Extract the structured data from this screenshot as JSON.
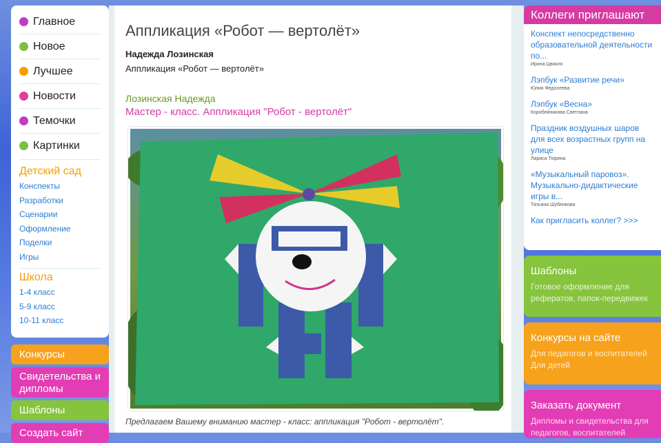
{
  "left_nav": {
    "main": [
      {
        "label": "Главное",
        "color": "#c23bc4"
      },
      {
        "label": "Новое",
        "color": "#7cc040"
      },
      {
        "label": "Лучшее",
        "color": "#f1a100"
      },
      {
        "label": "Новости",
        "color": "#e23d9b"
      },
      {
        "label": "Темочки",
        "color": "#c23bc4"
      },
      {
        "label": "Картинки",
        "color": "#7cc040"
      }
    ],
    "kindergarten": {
      "title": "Детский сад",
      "color": "#f1a100",
      "links": [
        "Конспекты",
        "Разработки",
        "Сценарии",
        "Оформление",
        "Поделки",
        "Игры"
      ]
    },
    "school": {
      "title": "Школа",
      "color": "#f1a100",
      "links": [
        "1-4 класс",
        "5-9 класс",
        "10-11 класс"
      ]
    },
    "buttons": [
      {
        "label": "Конкурсы",
        "color": "#f6a21c"
      },
      {
        "label": "Свидетельства и дипломы",
        "color": "#e23db5"
      },
      {
        "label": "Шаблоны",
        "color": "#86c43d"
      },
      {
        "label": "Создать сайт",
        "color": "#e23db5"
      }
    ]
  },
  "article": {
    "title": "Аппликация «Робот — вертолёт»",
    "author": "Надежда Лозинская",
    "subtitle": "Аппликация «Робот — вертолёт»",
    "author_line": "Лозинская Надежда",
    "mc_title": "Мастер - класс. Аппликация \"Робот - вертолёт\"",
    "caption": "Предлагаем Вашему вниманию мастер - класс: аппликация \"Робот - вертолёт\"."
  },
  "colleagues": {
    "title": "Коллеги приглашают",
    "items": [
      {
        "link": "Конспект непосредственно образовательной деятельности по...",
        "name": "Ирина Цвикло"
      },
      {
        "link": "Лэпбук «Развитие речи»",
        "name": "Юлия Федосеева"
      },
      {
        "link": "Лэпбук «Весна»",
        "name": "Коробейникова Светлана"
      },
      {
        "link": "Праздник воздушных шаров для всех возрастных групп на улице",
        "name": "Лариса Тюрина"
      },
      {
        "link": "«Музыкальный паровоз». Музыкально-дидактические игры в...",
        "name": "Татьяна Шубенкова"
      }
    ],
    "invite": "Как пригласить коллег? >>>"
  },
  "promo": [
    {
      "title": "Шаблоны",
      "desc": "Готовое оформление для рефератов, папок-передвижек",
      "color": "#86c43d"
    },
    {
      "title": "Конкурсы на сайте",
      "desc": "Для педагогов и воспитателей\nДля детей",
      "color": "#f6a21c"
    },
    {
      "title": "Заказать документ",
      "desc": "Дипломы и свидетельства для педагогов, воспитателей",
      "color": "#e23db5"
    }
  ]
}
